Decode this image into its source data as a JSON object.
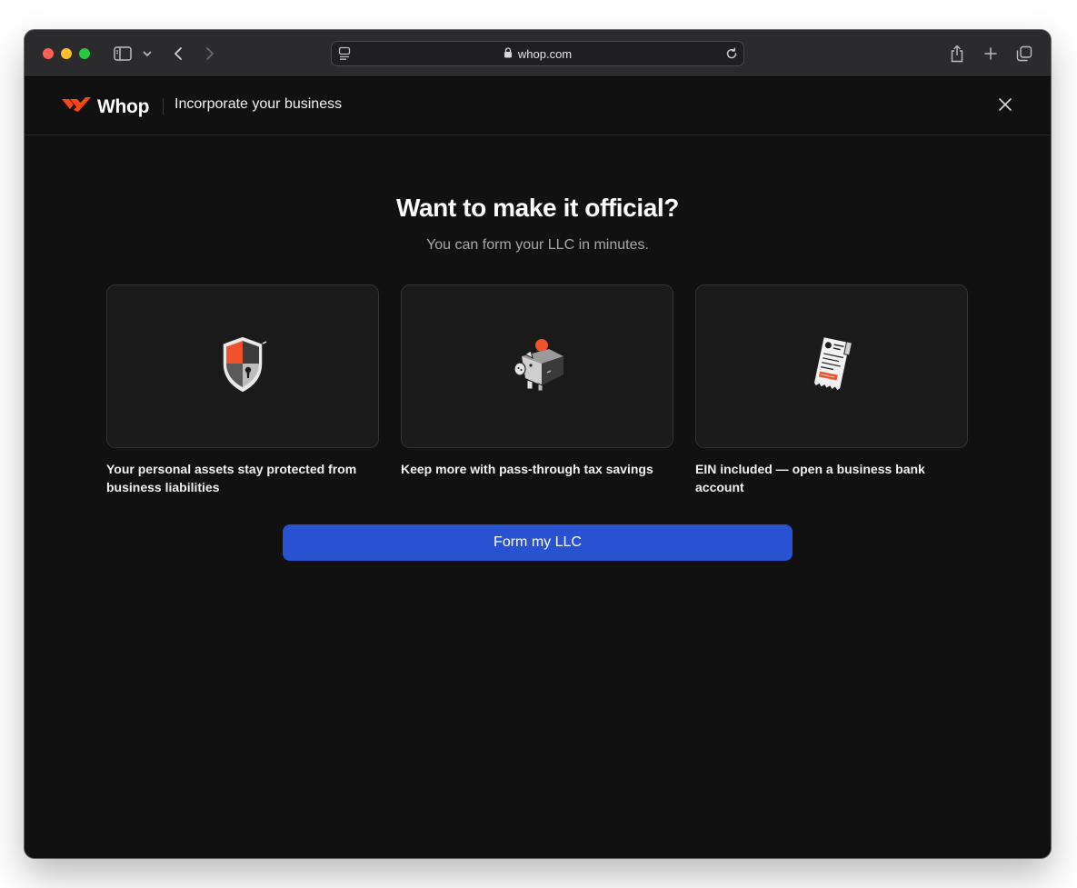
{
  "browser": {
    "url": "whop.com"
  },
  "header": {
    "brand": "Whop",
    "title": "Incorporate your business"
  },
  "hero": {
    "title": "Want to make it official?",
    "subtitle": "You can form your LLC in minutes."
  },
  "features": [
    {
      "icon": "shield-lock-icon",
      "caption": "Your personal assets stay protected from business liabilities"
    },
    {
      "icon": "piggy-bank-icon",
      "caption": "Keep more with pass-through tax savings"
    },
    {
      "icon": "receipt-icon",
      "caption": "EIN included — open a business bank account"
    }
  ],
  "cta": {
    "label": "Form my LLC"
  },
  "colors": {
    "brand": "#fa4616",
    "cta": "#2952d3",
    "background": "#111111"
  }
}
